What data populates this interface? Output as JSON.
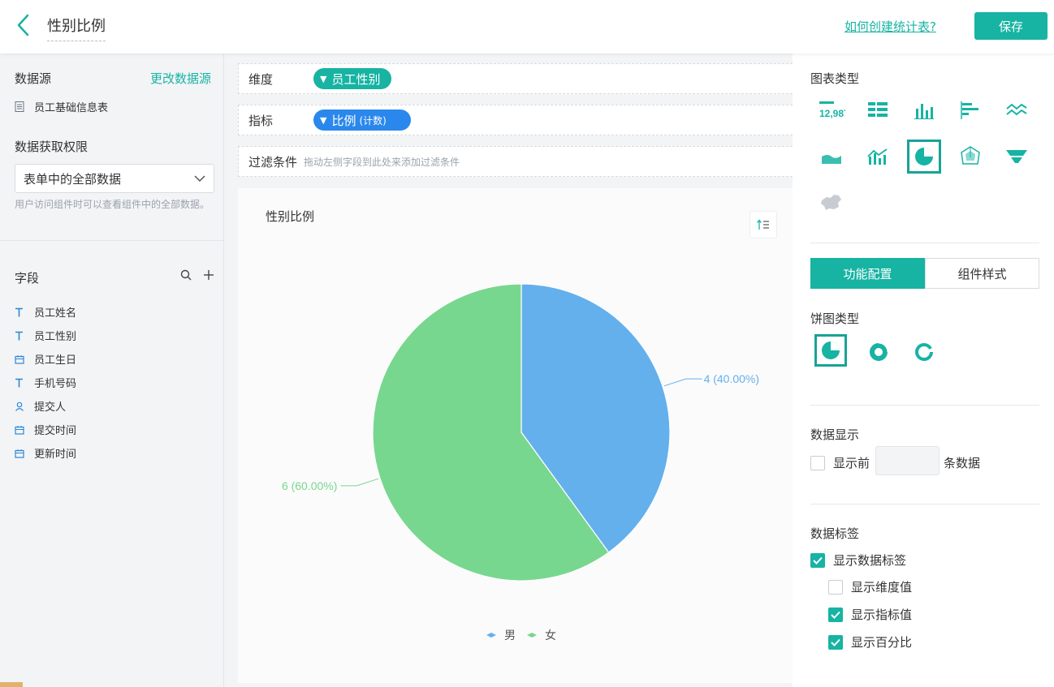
{
  "header": {
    "title": "性别比例",
    "help_link": "如何创建统计表?",
    "save_label": "保存"
  },
  "left_panel": {
    "data_source_label": "数据源",
    "change_source_label": "更改数据源",
    "source_table": "员工基础信息表",
    "permission_label": "数据获取权限",
    "permission_value": "表单中的全部数据",
    "permission_hint": "用户访问组件时可以查看组件中的全部数据。",
    "fields_label": "字段",
    "fields": [
      {
        "name": "员工姓名",
        "icon": "text-T-icon"
      },
      {
        "name": "员工性别",
        "icon": "text-T-icon"
      },
      {
        "name": "员工生日",
        "icon": "calendar-icon"
      },
      {
        "name": "手机号码",
        "icon": "text-T-icon"
      },
      {
        "name": "提交人",
        "icon": "person-icon"
      },
      {
        "name": "提交时间",
        "icon": "calendar-icon"
      },
      {
        "name": "更新时间",
        "icon": "calendar-icon"
      }
    ]
  },
  "config": {
    "dimension_label": "维度",
    "dimension_value": "员工性别",
    "metric_label": "指标",
    "metric_value": "比例",
    "metric_sub": "(计数)",
    "filter_label": "过滤条件",
    "filter_placeholder": "拖动左侧字段到此处来添加过滤条件"
  },
  "chart_data": {
    "type": "pie",
    "title": "性别比例",
    "categories": [
      "男",
      "女"
    ],
    "values": [
      4,
      6
    ],
    "percentages": [
      40.0,
      60.0
    ],
    "data_labels": [
      "4 (40.00%)",
      "6 (60.00%)"
    ],
    "colors": [
      "#64b0ec",
      "#78d78f"
    ],
    "legend": "bottom-center"
  },
  "right_panel": {
    "chart_type_label": "图表类型",
    "chart_types": [
      "number-card-icon",
      "table-icon",
      "bar-chart-icon",
      "horizontal-bar-icon",
      "line-chart-icon",
      "area-chart-icon",
      "combo-chart-icon",
      "pie-chart-icon",
      "radar-chart-icon",
      "funnel-chart-icon",
      "map-icon"
    ],
    "selected_chart_type": "pie-chart-icon",
    "tab_function": "功能配置",
    "tab_style": "组件样式",
    "pie_type_label": "饼图类型",
    "data_display_label": "数据显示",
    "show_top_label": "显示前",
    "show_top_suffix": "条数据",
    "data_labels_title": "数据标签",
    "show_data_labels": "显示数据标签",
    "show_dimension_value": "显示维度值",
    "show_metric_value": "显示指标值",
    "show_percentage": "显示百分比"
  },
  "colors": {
    "accent": "#17b3a3",
    "pill_teal": "#17b3a3",
    "pill_blue": "#2a88ec"
  }
}
